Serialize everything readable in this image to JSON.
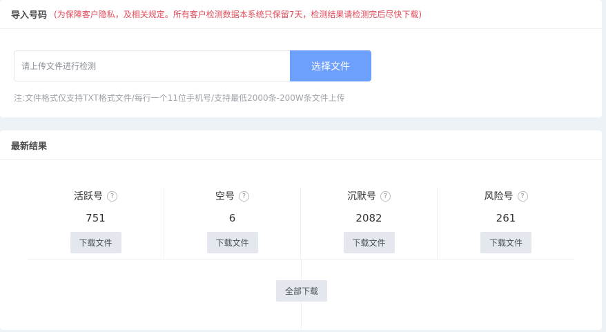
{
  "import": {
    "title": "导入号码",
    "notice": "(为保障客户隐私，及相关规定。所有客户检测数据本系统只保留7天，检测结果请检测完后尽快下载)",
    "input_placeholder": "请上传文件进行检测",
    "select_button": "选择文件",
    "note": "注:文件格式仅支持TXT格式文件/每行一个11位手机号/支持最低2000条-200W条文件上传"
  },
  "results": {
    "title": "最新结果",
    "help_glyph": "?",
    "stats": [
      {
        "label": "活跃号",
        "value": "751",
        "download": "下载文件"
      },
      {
        "label": "空号",
        "value": "6",
        "download": "下载文件"
      },
      {
        "label": "沉默号",
        "value": "2082",
        "download": "下载文件"
      },
      {
        "label": "风险号",
        "value": "261",
        "download": "下载文件"
      }
    ],
    "download_all": "全部下载"
  },
  "colors": {
    "accent": "#6d9ffc",
    "notice": "#e04a5a",
    "page_bg": "#edf2f6"
  }
}
